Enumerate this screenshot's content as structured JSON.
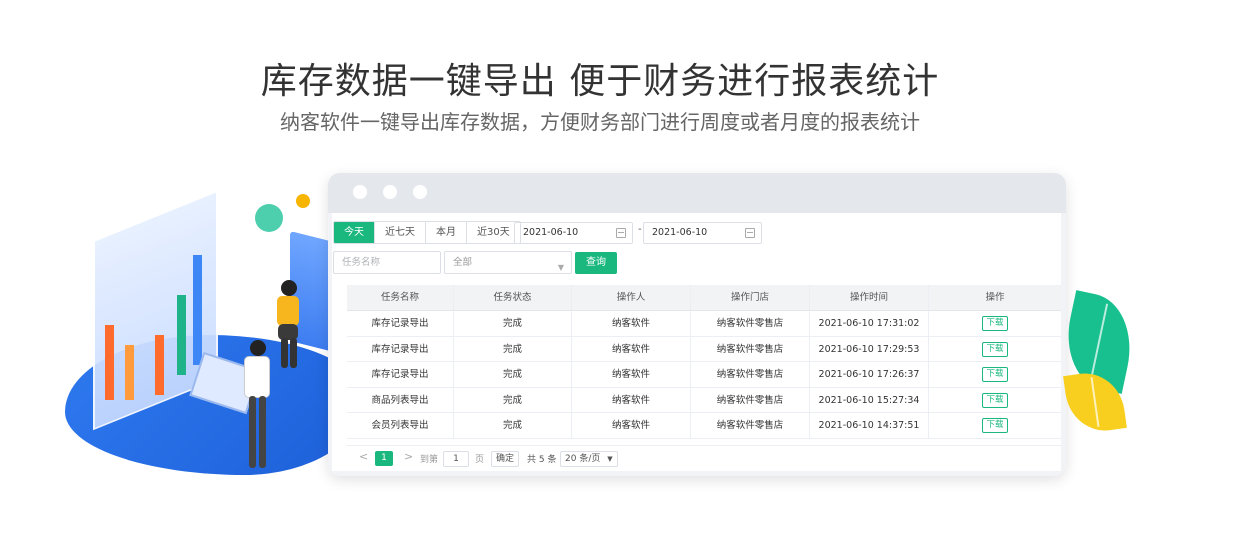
{
  "headline": "库存数据一键导出 便于财务进行报表统计",
  "subheadline": "纳客软件一键导出库存数据，方便财务部门进行周度或者月度的报表统计",
  "filters": {
    "range_tabs": [
      "今天",
      "近七天",
      "本月",
      "近30天"
    ],
    "active_tab": "今天",
    "date_start": "2021-06-10",
    "date_end": "2021-06-10",
    "date_separator": "-",
    "task_name_placeholder": "任务名称",
    "status_select": "全部",
    "query_label": "查询"
  },
  "table": {
    "columns": [
      "任务名称",
      "任务状态",
      "操作人",
      "操作门店",
      "操作时间",
      "操作"
    ],
    "rows": [
      [
        "库存记录导出",
        "完成",
        "纳客软件",
        "纳客软件零售店",
        "2021-06-10 17:31:02",
        "下载"
      ],
      [
        "库存记录导出",
        "完成",
        "纳客软件",
        "纳客软件零售店",
        "2021-06-10 17:29:53",
        "下载"
      ],
      [
        "库存记录导出",
        "完成",
        "纳客软件",
        "纳客软件零售店",
        "2021-06-10 17:26:37",
        "下载"
      ],
      [
        "商品列表导出",
        "完成",
        "纳客软件",
        "纳客软件零售店",
        "2021-06-10 15:27:34",
        "下载"
      ],
      [
        "会员列表导出",
        "完成",
        "纳客软件",
        "纳客软件零售店",
        "2021-06-10 14:37:51",
        "下载"
      ]
    ]
  },
  "pager": {
    "prev": "<",
    "current_page": "1",
    "next": ">",
    "goto_label": "到第",
    "goto_value": "1",
    "page_unit": "页",
    "confirm": "确定",
    "total": "共 5 条",
    "page_size": "20 条/页"
  },
  "colors": {
    "accent": "#1ab87f",
    "illustration_blue": "#2f7af0",
    "leaf_green": "#17c08e",
    "leaf_yellow": "#f8cf1e"
  }
}
